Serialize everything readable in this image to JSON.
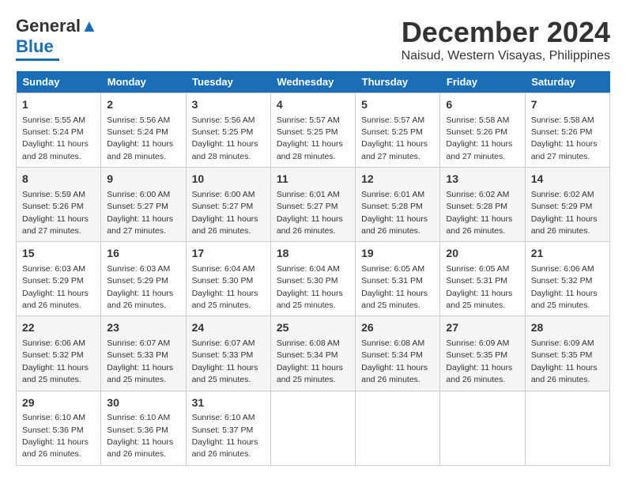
{
  "logo": {
    "line1": "General",
    "line2": "Blue"
  },
  "title": "December 2024",
  "subtitle": "Naisud, Western Visayas, Philippines",
  "days_of_week": [
    "Sunday",
    "Monday",
    "Tuesday",
    "Wednesday",
    "Thursday",
    "Friday",
    "Saturday"
  ],
  "weeks": [
    [
      {
        "num": "1",
        "sr": "5:55 AM",
        "ss": "5:24 PM",
        "dl": "11 hours and 28 minutes."
      },
      {
        "num": "2",
        "sr": "5:56 AM",
        "ss": "5:24 PM",
        "dl": "11 hours and 28 minutes."
      },
      {
        "num": "3",
        "sr": "5:56 AM",
        "ss": "5:25 PM",
        "dl": "11 hours and 28 minutes."
      },
      {
        "num": "4",
        "sr": "5:57 AM",
        "ss": "5:25 PM",
        "dl": "11 hours and 28 minutes."
      },
      {
        "num": "5",
        "sr": "5:57 AM",
        "ss": "5:25 PM",
        "dl": "11 hours and 27 minutes."
      },
      {
        "num": "6",
        "sr": "5:58 AM",
        "ss": "5:26 PM",
        "dl": "11 hours and 27 minutes."
      },
      {
        "num": "7",
        "sr": "5:58 AM",
        "ss": "5:26 PM",
        "dl": "11 hours and 27 minutes."
      }
    ],
    [
      {
        "num": "8",
        "sr": "5:59 AM",
        "ss": "5:26 PM",
        "dl": "11 hours and 27 minutes."
      },
      {
        "num": "9",
        "sr": "6:00 AM",
        "ss": "5:27 PM",
        "dl": "11 hours and 27 minutes."
      },
      {
        "num": "10",
        "sr": "6:00 AM",
        "ss": "5:27 PM",
        "dl": "11 hours and 26 minutes."
      },
      {
        "num": "11",
        "sr": "6:01 AM",
        "ss": "5:27 PM",
        "dl": "11 hours and 26 minutes."
      },
      {
        "num": "12",
        "sr": "6:01 AM",
        "ss": "5:28 PM",
        "dl": "11 hours and 26 minutes."
      },
      {
        "num": "13",
        "sr": "6:02 AM",
        "ss": "5:28 PM",
        "dl": "11 hours and 26 minutes."
      },
      {
        "num": "14",
        "sr": "6:02 AM",
        "ss": "5:29 PM",
        "dl": "11 hours and 26 minutes."
      }
    ],
    [
      {
        "num": "15",
        "sr": "6:03 AM",
        "ss": "5:29 PM",
        "dl": "11 hours and 26 minutes."
      },
      {
        "num": "16",
        "sr": "6:03 AM",
        "ss": "5:29 PM",
        "dl": "11 hours and 26 minutes."
      },
      {
        "num": "17",
        "sr": "6:04 AM",
        "ss": "5:30 PM",
        "dl": "11 hours and 25 minutes."
      },
      {
        "num": "18",
        "sr": "6:04 AM",
        "ss": "5:30 PM",
        "dl": "11 hours and 25 minutes."
      },
      {
        "num": "19",
        "sr": "6:05 AM",
        "ss": "5:31 PM",
        "dl": "11 hours and 25 minutes."
      },
      {
        "num": "20",
        "sr": "6:05 AM",
        "ss": "5:31 PM",
        "dl": "11 hours and 25 minutes."
      },
      {
        "num": "21",
        "sr": "6:06 AM",
        "ss": "5:32 PM",
        "dl": "11 hours and 25 minutes."
      }
    ],
    [
      {
        "num": "22",
        "sr": "6:06 AM",
        "ss": "5:32 PM",
        "dl": "11 hours and 25 minutes."
      },
      {
        "num": "23",
        "sr": "6:07 AM",
        "ss": "5:33 PM",
        "dl": "11 hours and 25 minutes."
      },
      {
        "num": "24",
        "sr": "6:07 AM",
        "ss": "5:33 PM",
        "dl": "11 hours and 25 minutes."
      },
      {
        "num": "25",
        "sr": "6:08 AM",
        "ss": "5:34 PM",
        "dl": "11 hours and 25 minutes."
      },
      {
        "num": "26",
        "sr": "6:08 AM",
        "ss": "5:34 PM",
        "dl": "11 hours and 26 minutes."
      },
      {
        "num": "27",
        "sr": "6:09 AM",
        "ss": "5:35 PM",
        "dl": "11 hours and 26 minutes."
      },
      {
        "num": "28",
        "sr": "6:09 AM",
        "ss": "5:35 PM",
        "dl": "11 hours and 26 minutes."
      }
    ],
    [
      {
        "num": "29",
        "sr": "6:10 AM",
        "ss": "5:36 PM",
        "dl": "11 hours and 26 minutes."
      },
      {
        "num": "30",
        "sr": "6:10 AM",
        "ss": "5:36 PM",
        "dl": "11 hours and 26 minutes."
      },
      {
        "num": "31",
        "sr": "6:10 AM",
        "ss": "5:37 PM",
        "dl": "11 hours and 26 minutes."
      },
      null,
      null,
      null,
      null
    ]
  ]
}
